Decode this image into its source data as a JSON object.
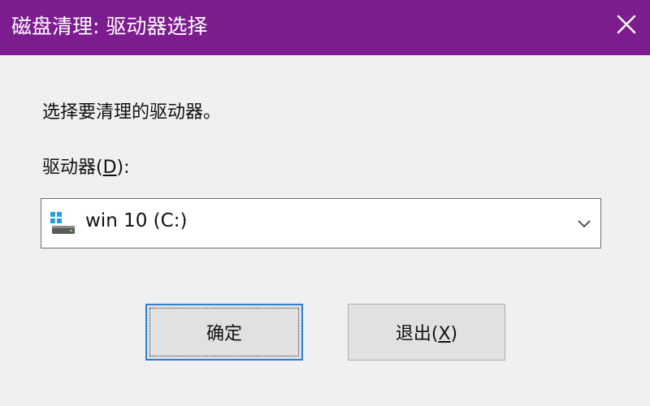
{
  "window": {
    "title": "磁盘清理: 驱动器选择",
    "close_glyph": "✕",
    "titlebar_color": "#7d1c8f"
  },
  "dialog": {
    "prompt": "选择要清理的驱动器。",
    "drive_label_prefix": "驱动器(",
    "drive_label_key": "D",
    "drive_label_suffix": "):",
    "drive_select": {
      "value": "win 10 (C:)",
      "icon": "windows-drive-icon"
    }
  },
  "buttons": {
    "ok_label": "确定",
    "exit_prefix": "退出(",
    "exit_key": "X",
    "exit_suffix": ")"
  }
}
